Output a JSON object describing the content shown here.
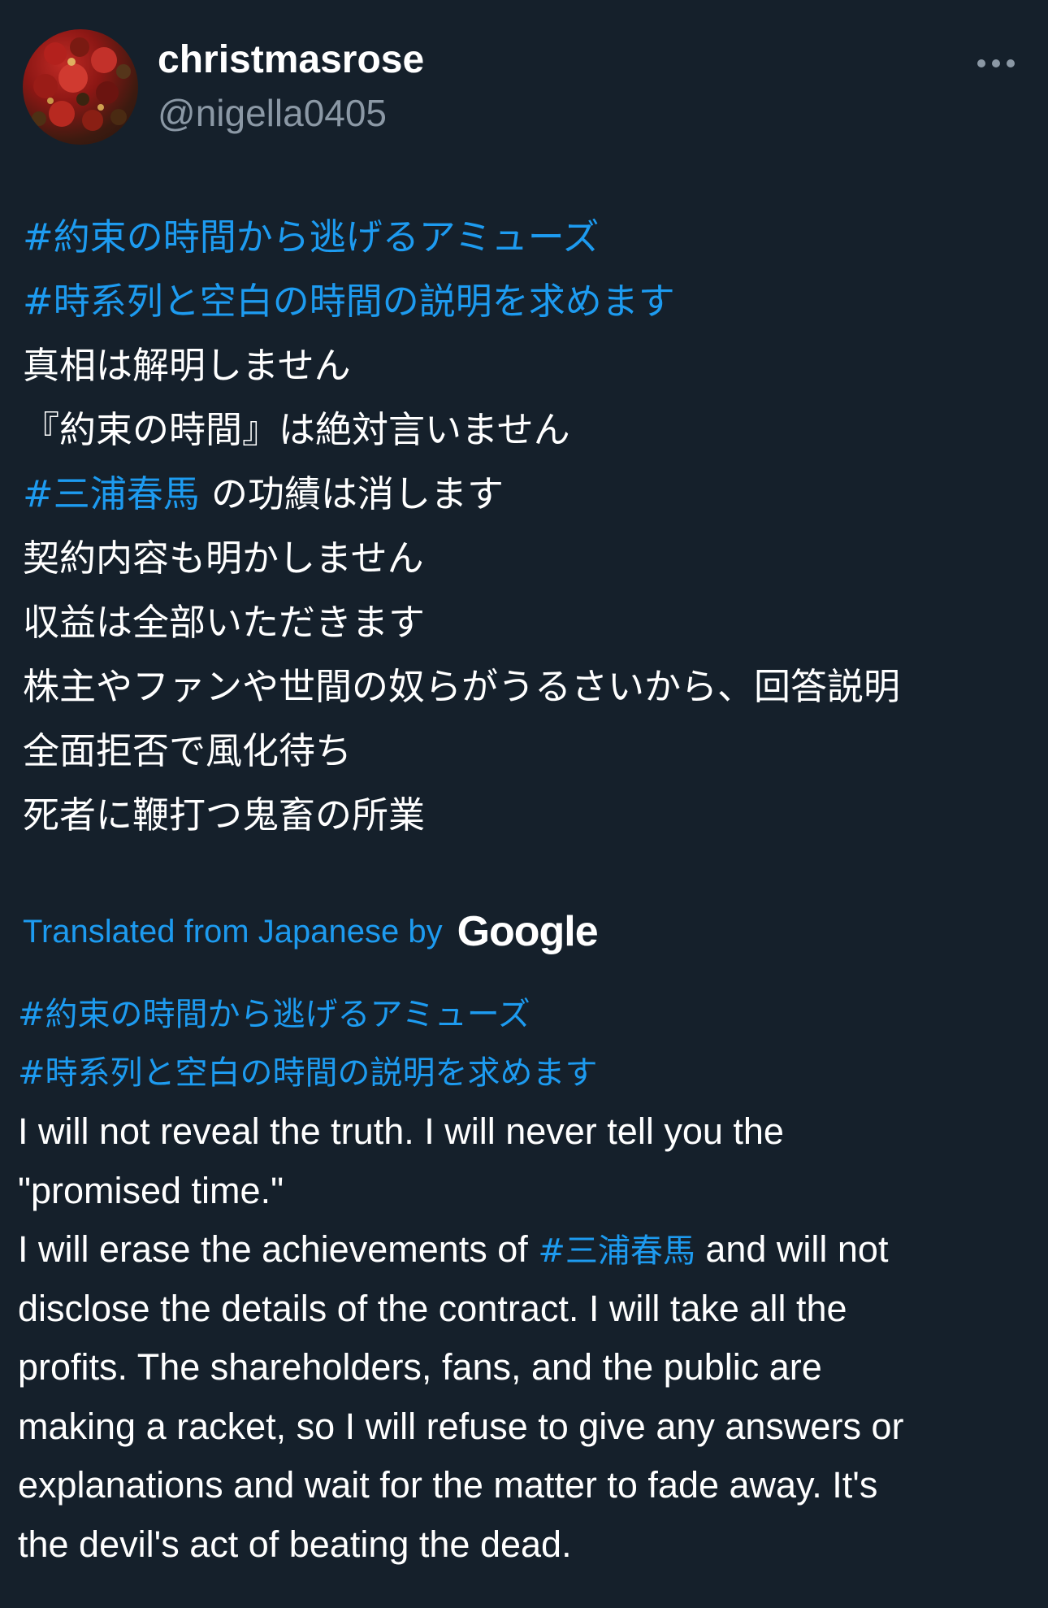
{
  "user": {
    "display_name": "christmasrose",
    "handle": "@nigella0405"
  },
  "icons": {
    "avatar": "avatar-photo",
    "more": "more-horizontal-icon",
    "google": "google-logo"
  },
  "colors": {
    "background": "#15202b",
    "link": "#1d9bf0",
    "text": "#ffffff",
    "secondary": "#8b98a5"
  },
  "original": {
    "line1": "#約束の時間から逃げるアミューズ",
    "line2": "#時系列と空白の時間の説明を求めます",
    "line3": "真相は解明しません",
    "line4": "『約束の時間』は絶対言いません",
    "line5_hashtag": "#三浦春馬",
    "line5_text": " の功績は消します",
    "line6": "契約内容も明かしません",
    "line7": "収益は全部いただきます",
    "line8": "株主やファンや世間の奴らがうるさいから、回答説明",
    "line9": "全面拒否で風化待ち",
    "line10": "死者に鞭打つ鬼畜の所業"
  },
  "translation_notice": {
    "label": "Translated from Japanese by",
    "provider": "Google"
  },
  "translation": {
    "hashtag1": "#約束の時間から逃げるアミューズ",
    "hashtag2": "#時系列と空白の時間の説明を求めます",
    "line1": "I will not reveal the truth. I will never tell you the",
    "line2": "\"promised time.\"",
    "line3_before": "I will erase the achievements of ",
    "line3_hashtag": "#三浦春馬",
    "line3_after": " and will not",
    "line4": "disclose the details of the contract. I will take all the",
    "line5": "profits. The shareholders, fans, and the public are",
    "line6": "making a racket, so I will refuse to give any answers or",
    "line7": "explanations and wait for the matter to fade away. It's",
    "line8": "the devil's act of beating the dead."
  }
}
